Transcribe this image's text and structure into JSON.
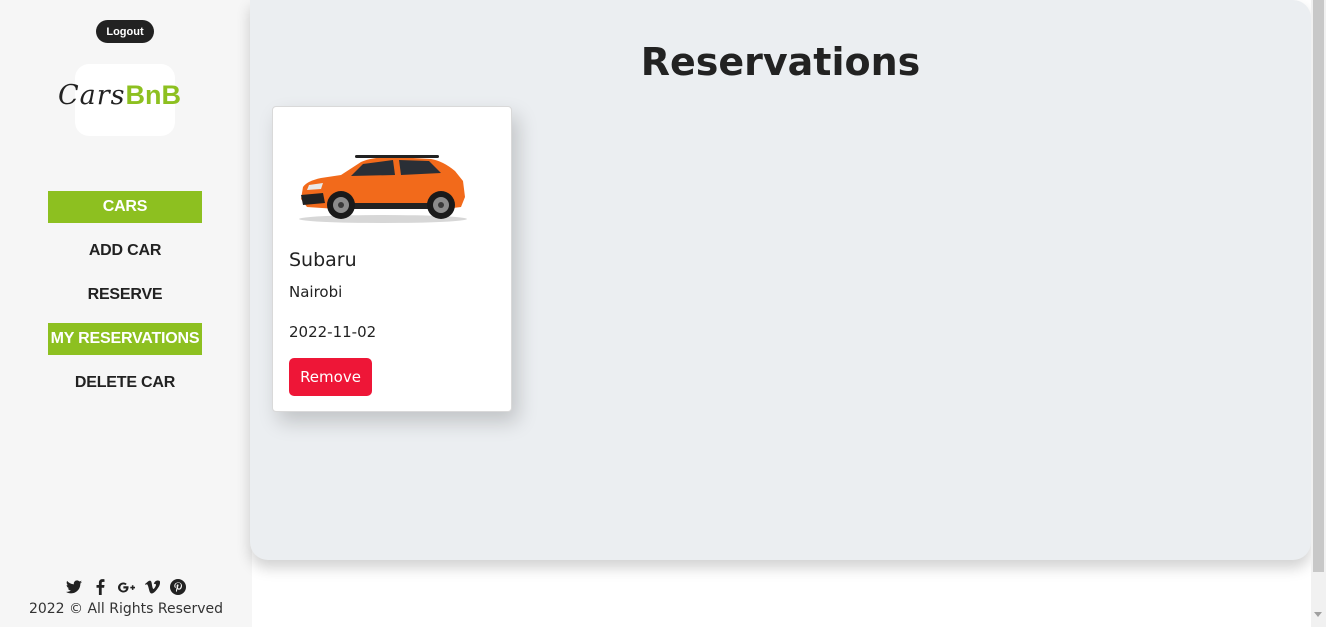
{
  "header": {
    "logout_label": "Logout"
  },
  "brand": {
    "part1": "Cars",
    "part2": "BnB",
    "accent_color": "#8dc020"
  },
  "sidebar": {
    "items": [
      {
        "label": "CARS",
        "active": true
      },
      {
        "label": "ADD CAR",
        "active": false
      },
      {
        "label": "RESERVE",
        "active": false
      },
      {
        "label": "MY RESERVATIONS",
        "active": true
      },
      {
        "label": "DELETE CAR",
        "active": false
      }
    ],
    "social_icons": [
      "twitter-icon",
      "facebook-icon",
      "google-plus-icon",
      "vimeo-icon",
      "pinterest-icon"
    ],
    "copyright": "2022 © All Rights Reserved"
  },
  "main": {
    "title": "Reservations",
    "reservations": [
      {
        "car_name": "Subaru",
        "city": "Nairobi",
        "date": "2022-11-02",
        "remove_label": "Remove",
        "car_color": "#f26a1b"
      }
    ]
  },
  "colors": {
    "remove_button": "#ee1637",
    "panel_bg": "#ebeef1"
  }
}
